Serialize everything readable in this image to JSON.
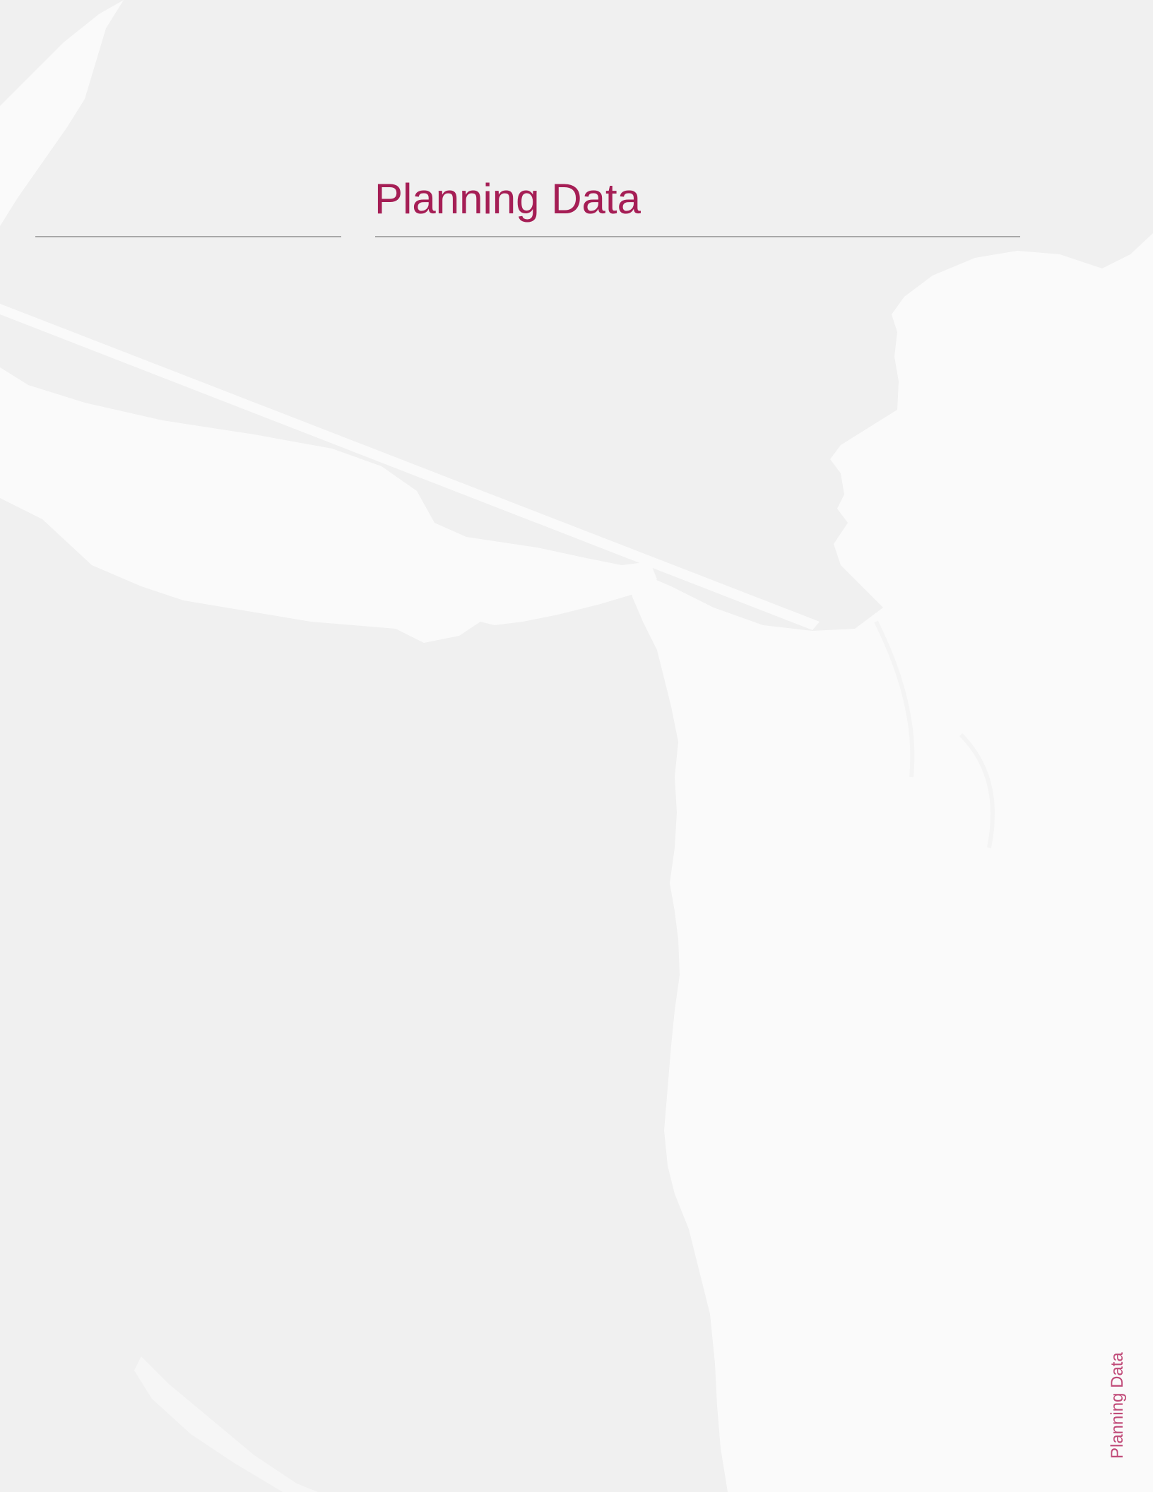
{
  "page": {
    "title": "Planning Data",
    "side_label": "Planning Data"
  },
  "colors": {
    "background": "#f0f0f0",
    "accent": "#a51e55",
    "rule": "#a8a8a8",
    "silhouette": "#fafafa"
  },
  "decor": {
    "background_image": "javelin-thrower-silhouette"
  }
}
